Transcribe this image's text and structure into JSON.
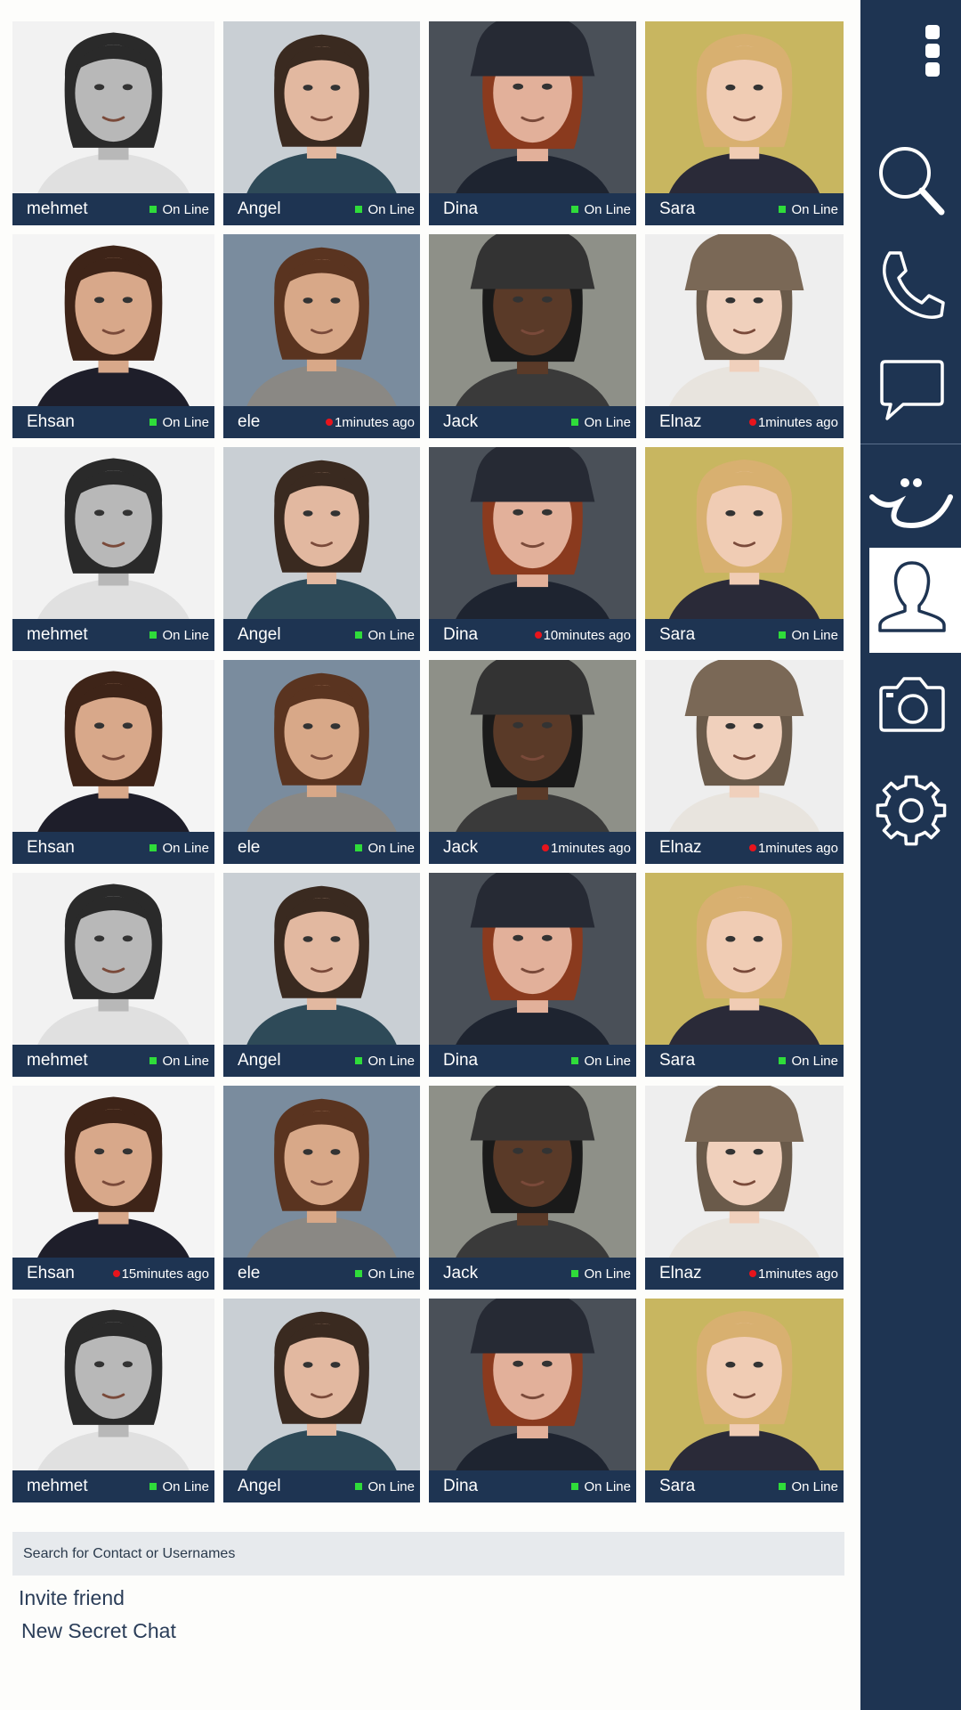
{
  "contacts": [
    {
      "name": "mehmet",
      "status": "On Line",
      "online": true,
      "photo": "man-bw"
    },
    {
      "name": "Angel",
      "status": "On Line",
      "online": true,
      "photo": "woman-scarf"
    },
    {
      "name": "Dina",
      "status": "On Line",
      "online": true,
      "photo": "woman-red-hood"
    },
    {
      "name": "Sara",
      "status": "On Line",
      "online": true,
      "photo": "girl-blonde"
    },
    {
      "name": "Ehsan",
      "status": "On Line",
      "online": true,
      "photo": "man-dark-hair"
    },
    {
      "name": "ele",
      "status": "1minutes ago",
      "online": false,
      "photo": "woman-curly"
    },
    {
      "name": "Jack",
      "status": "On Line",
      "online": true,
      "photo": "man-hat-glasses"
    },
    {
      "name": "Elnaz",
      "status": "1minutes ago",
      "online": false,
      "photo": "baby-fur-hat"
    },
    {
      "name": "mehmet",
      "status": "On Line",
      "online": true,
      "photo": "man-bw"
    },
    {
      "name": "Angel",
      "status": "On Line",
      "online": true,
      "photo": "woman-scarf"
    },
    {
      "name": "Dina",
      "status": "10minutes ago",
      "online": false,
      "photo": "woman-red-hood"
    },
    {
      "name": "Sara",
      "status": "On Line",
      "online": true,
      "photo": "girl-blonde"
    },
    {
      "name": "Ehsan",
      "status": "On Line",
      "online": true,
      "photo": "man-dark-hair"
    },
    {
      "name": "ele",
      "status": "On Line",
      "online": true,
      "photo": "woman-curly"
    },
    {
      "name": "Jack",
      "status": "1minutes ago",
      "online": false,
      "photo": "man-hat-glasses"
    },
    {
      "name": "Elnaz",
      "status": "1minutes ago",
      "online": false,
      "photo": "baby-fur-hat"
    },
    {
      "name": "mehmet",
      "status": "On Line",
      "online": true,
      "photo": "man-bw"
    },
    {
      "name": "Angel",
      "status": "On Line",
      "online": true,
      "photo": "woman-scarf"
    },
    {
      "name": "Dina",
      "status": "On Line",
      "online": true,
      "photo": "woman-red-hood"
    },
    {
      "name": "Sara",
      "status": "On Line",
      "online": true,
      "photo": "girl-blonde"
    },
    {
      "name": "Ehsan",
      "status": "15minutes ago",
      "online": false,
      "photo": "man-dark-hair"
    },
    {
      "name": "ele",
      "status": "On Line",
      "online": true,
      "photo": "woman-curly"
    },
    {
      "name": "Jack",
      "status": "On Line",
      "online": true,
      "photo": "man-hat-glasses"
    },
    {
      "name": "Elnaz",
      "status": "1minutes ago",
      "online": false,
      "photo": "baby-fur-hat"
    },
    {
      "name": "mehmet",
      "status": "On Line",
      "online": true,
      "photo": "man-bw"
    },
    {
      "name": "Angel",
      "status": "On Line",
      "online": true,
      "photo": "woman-scarf"
    },
    {
      "name": "Dina",
      "status": "On Line",
      "online": true,
      "photo": "woman-red-hood"
    },
    {
      "name": "Sara",
      "status": "On Line",
      "online": true,
      "photo": "girl-blonde"
    }
  ],
  "photo_styles": {
    "man-bw": {
      "bg": "#f2f2f2",
      "skin": "#b8b8b8",
      "hair": "#2a2a2a",
      "cloth": "#e0e0e0",
      "hat": ""
    },
    "woman-scarf": {
      "bg": "#c9cfd4",
      "skin": "#e2b8a0",
      "hair": "#3a2a20",
      "cloth": "#2e4a58",
      "hat": ""
    },
    "woman-red-hood": {
      "bg": "#4a5058",
      "skin": "#e2b09a",
      "hair": "#8a3a1e",
      "cloth": "#1e2430",
      "hat": "#262a34"
    },
    "girl-blonde": {
      "bg": "#c8b660",
      "skin": "#f0ccb4",
      "hair": "#d8b070",
      "cloth": "#2a2a38",
      "hat": ""
    },
    "man-dark-hair": {
      "bg": "#f4f4f4",
      "skin": "#d8a88a",
      "hair": "#3e2418",
      "cloth": "#1e1e2a",
      "hat": ""
    },
    "woman-curly": {
      "bg": "#7a8c9e",
      "skin": "#d8a888",
      "hair": "#5a3420",
      "cloth": "#8a8884",
      "hat": ""
    },
    "man-hat-glasses": {
      "bg": "#8e9088",
      "skin": "#5a3a28",
      "hair": "#1a1a1a",
      "cloth": "#3a3a3a",
      "hat": "#333333"
    },
    "baby-fur-hat": {
      "bg": "#eeeeee",
      "skin": "#f0d0bc",
      "hair": "#6a5a4a",
      "cloth": "#e8e4de",
      "hat": "#7a6856"
    }
  },
  "search": {
    "placeholder": "Search for Contact or Usernames"
  },
  "actions": {
    "invite": "Invite friend",
    "secret": "New Secret Chat"
  },
  "sidebar": {
    "items": [
      "more-icon",
      "search-icon",
      "phone-icon",
      "chat-icon",
      "smiley-icon",
      "profile-icon",
      "camera-icon",
      "gear-icon"
    ]
  },
  "colors": {
    "navy": "#1e3452",
    "online": "#2fdc3a",
    "away": "#e8141c"
  }
}
